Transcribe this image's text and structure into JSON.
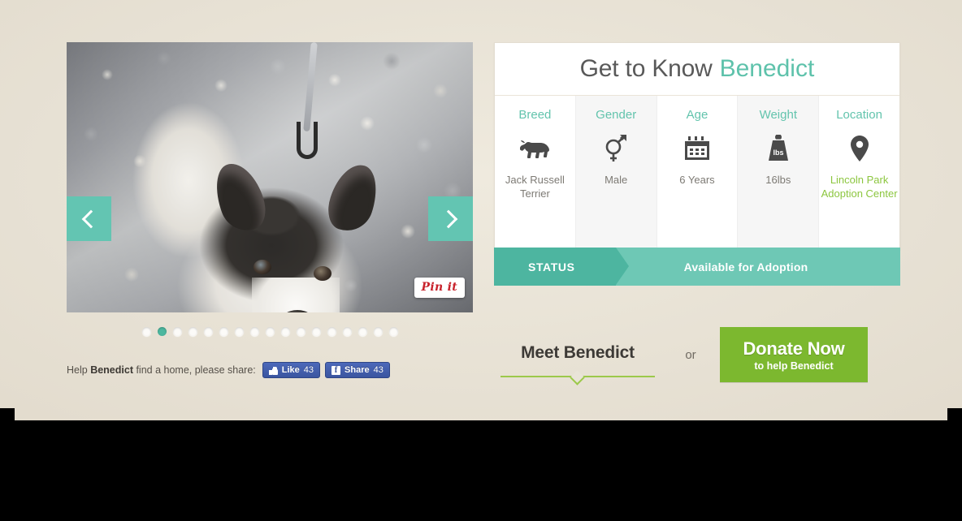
{
  "colors": {
    "page_background": "#e9e4d8",
    "teal": "#63c5b2",
    "teal_dark": "#4db5a0",
    "green": "#8cc63f",
    "donate_green": "#7cb82f",
    "facebook_blue": "#4c69ba",
    "pinterest_red": "#c8232c"
  },
  "carousel": {
    "prev_label": "Previous photo",
    "next_label": "Next photo",
    "prev_icon": "chevron-left-icon",
    "next_icon": "chevron-right-icon",
    "pin_it_label": "Pin it",
    "photo_alt": "Jack Russell Terrier on gravel looking up at camera",
    "dots_total": 17,
    "dots_active_index": 1
  },
  "share": {
    "prefix": "Help ",
    "pet_name": "Benedict",
    "suffix": " find a home, please share:",
    "like_label": "Like",
    "like_count": "43",
    "share_label": "Share",
    "share_count": "43"
  },
  "card": {
    "title_prefix": "Get to Know",
    "title_name": "Benedict",
    "cells": [
      {
        "label": "Breed",
        "icon": "dog-icon",
        "value": "Jack Russell Terrier"
      },
      {
        "label": "Gender",
        "icon": "gender-icon",
        "value": "Male"
      },
      {
        "label": "Age",
        "icon": "calendar-icon",
        "value": "6 Years"
      },
      {
        "label": "Weight",
        "icon": "weight-icon",
        "value": "16lbs"
      },
      {
        "label": "Location",
        "icon": "map-pin-icon",
        "value": "Lincoln Park Adoption Center"
      }
    ]
  },
  "status": {
    "label": "STATUS",
    "value": "Available for Adoption"
  },
  "cta": {
    "meet_label": "Meet Benedict",
    "or_label": "or",
    "donate_main": "Donate Now",
    "donate_sub": "to help Benedict"
  }
}
